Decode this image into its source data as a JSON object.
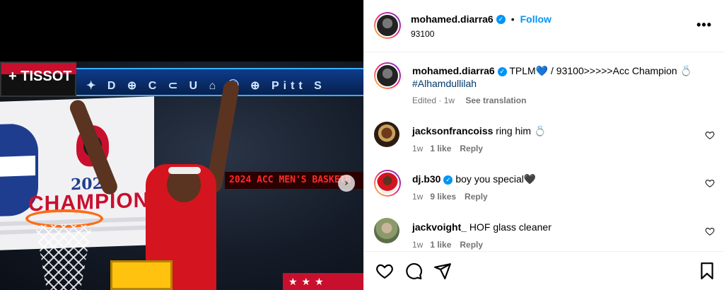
{
  "post": {
    "username": "mohamed.diarra6",
    "subtitle": "93100",
    "follow_label": "Follow",
    "dot": "•",
    "more_label": "•••",
    "next_label": "›"
  },
  "photo_scene": {
    "tissot": "+ TISSOT",
    "scoreboard": "✦ D ⊕ C ⊂ U ⌂ Ⓣ ⊕ Pitt S",
    "ticker": "2024 ACC MEN'S BASKETB",
    "champ_year": "2024",
    "champ_text": "CHAMPIONS",
    "stars": "★★★"
  },
  "caption": {
    "username": "mohamed.diarra6",
    "text": "TPLM💙 / 93100>>>>>Acc Champion 💍",
    "hashtag": "#Alhamdullilah",
    "meta": "Edited · 1w",
    "see_translation": "See translation"
  },
  "comments": [
    {
      "username": "jacksonfrancoiss",
      "verified": false,
      "text": "ring him 💍",
      "time": "1w",
      "likes": "1 like",
      "reply": "Reply"
    },
    {
      "username": "dj.b30",
      "verified": true,
      "text": "boy you special🖤",
      "time": "1w",
      "likes": "9 likes",
      "reply": "Reply"
    },
    {
      "username": "jackvoight_",
      "verified": false,
      "text": "HOF glass cleaner",
      "time": "1w",
      "likes": "1 like",
      "reply": "Reply"
    }
  ],
  "colors": {
    "accent": "#0095f6",
    "meta": "#737373",
    "hashtag": "#00376b"
  }
}
